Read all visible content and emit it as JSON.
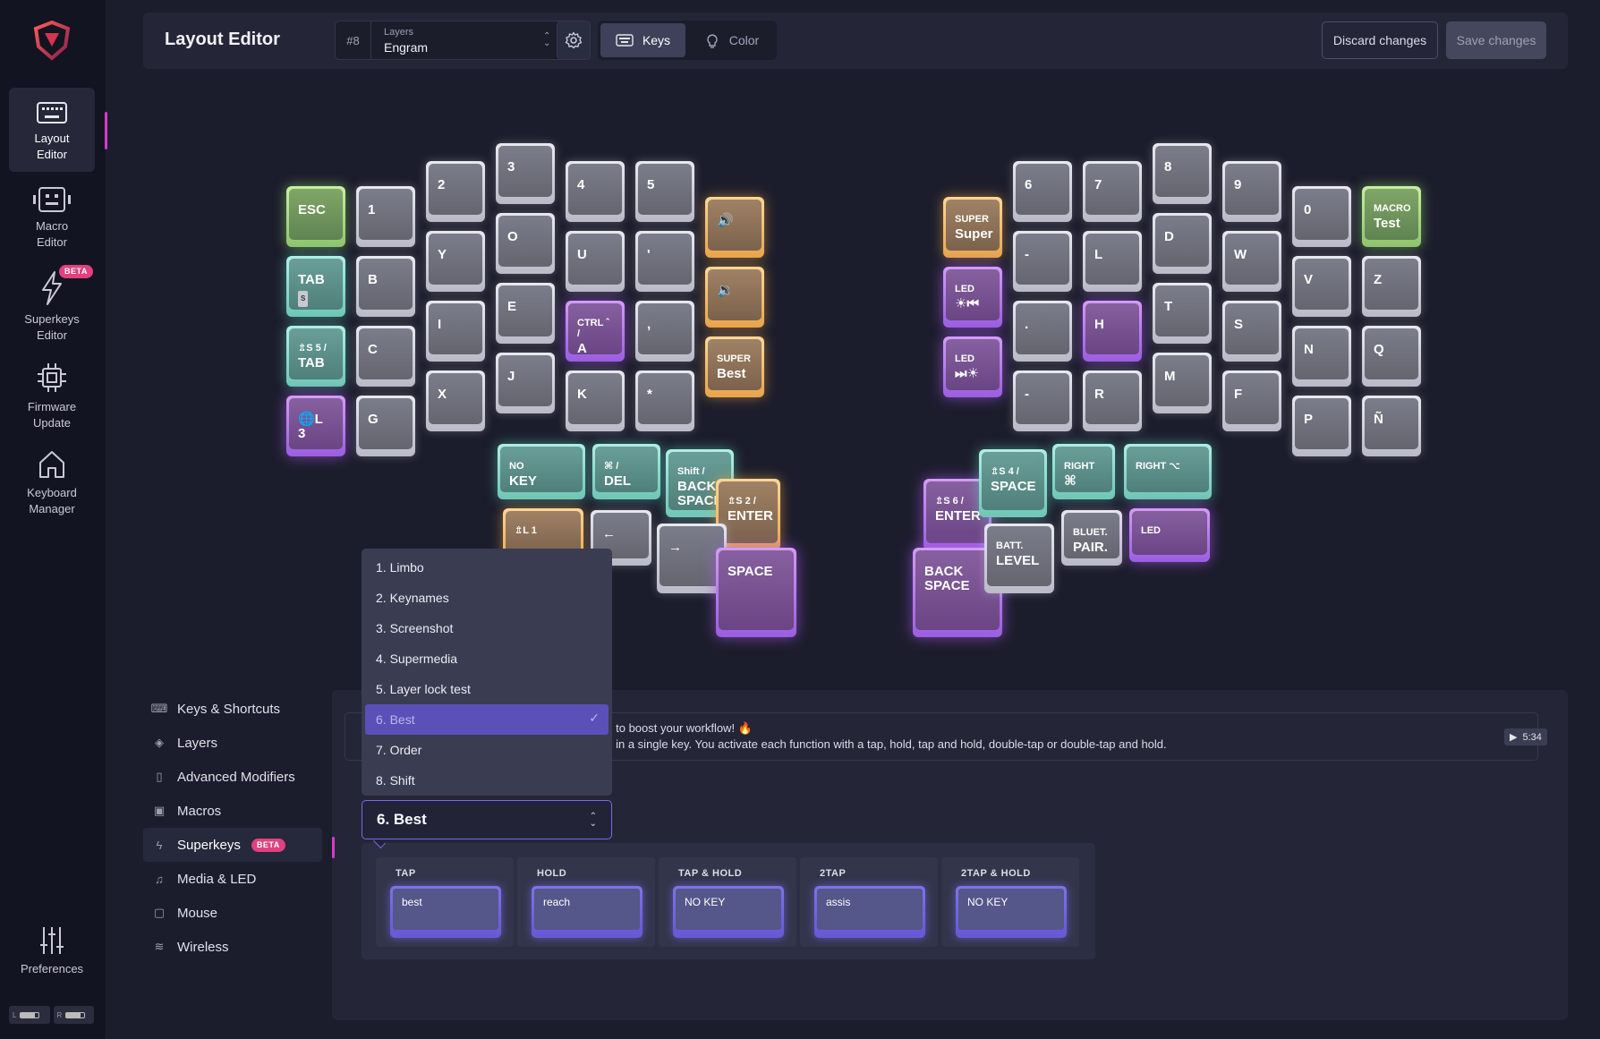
{
  "rail": {
    "items": [
      {
        "label_1": "Layout",
        "label_2": "Editor"
      },
      {
        "label_1": "Macro",
        "label_2": "Editor"
      },
      {
        "label_1": "Superkeys",
        "label_2": "Editor"
      },
      {
        "label_1": "Firmware",
        "label_2": "Update"
      },
      {
        "label_1": "Keyboard",
        "label_2": "Manager"
      }
    ],
    "beta": "BETA",
    "preferences": "Preferences",
    "battery": {
      "left": "L",
      "right": "R"
    }
  },
  "header": {
    "title": "Layout Editor",
    "layer_number": "#8",
    "layer_caption": "Layers",
    "layer_value": "Engram",
    "tab_keys": "Keys",
    "tab_color": "Color",
    "discard": "Discard changes",
    "save": "Save changes"
  },
  "keyboard": {
    "left_keys": [
      {
        "l1": "",
        "l2": "ESC",
        "color": "green"
      },
      {
        "l1": "",
        "l2": "1",
        "color": "gray"
      },
      {
        "l1": "",
        "l2": "2",
        "color": "gray"
      },
      {
        "l1": "",
        "l2": "3",
        "color": "gray"
      },
      {
        "l1": "",
        "l2": "4",
        "color": "gray"
      },
      {
        "l1": "",
        "l2": "5",
        "color": "gray"
      },
      {
        "l1": "",
        "l2": "🔊",
        "color": "orange"
      },
      {
        "l1": "",
        "l2": "TAB",
        "color": "teal",
        "badge": "S"
      },
      {
        "l1": "",
        "l2": "B",
        "color": "gray"
      },
      {
        "l1": "",
        "l2": "Y",
        "color": "gray"
      },
      {
        "l1": "",
        "l2": "O",
        "color": "gray"
      },
      {
        "l1": "",
        "l2": "U",
        "color": "gray"
      },
      {
        "l1": "",
        "l2": "'",
        "color": "gray"
      },
      {
        "l1": "",
        "l2": "🔉",
        "color": "orange"
      },
      {
        "l1": "⇬S 5 /",
        "l2": "TAB",
        "color": "teal"
      },
      {
        "l1": "",
        "l2": "C",
        "color": "gray"
      },
      {
        "l1": "",
        "l2": "I",
        "color": "gray"
      },
      {
        "l1": "",
        "l2": "E",
        "color": "gray"
      },
      {
        "l1": "CTRL ˆ /",
        "l2": "A",
        "color": "purple"
      },
      {
        "l1": "",
        "l2": ",",
        "color": "gray"
      },
      {
        "l1": "SUPER",
        "l2": "Best",
        "color": "orange"
      },
      {
        "l1": "",
        "l2": "🌐L 3",
        "color": "purple"
      },
      {
        "l1": "",
        "l2": "G",
        "color": "gray"
      },
      {
        "l1": "",
        "l2": "X",
        "color": "gray"
      },
      {
        "l1": "",
        "l2": "J",
        "color": "gray"
      },
      {
        "l1": "",
        "l2": "K",
        "color": "gray"
      },
      {
        "l1": "",
        "l2": "*",
        "color": "gray"
      }
    ],
    "left_thumb": [
      {
        "l1": "NO",
        "l2": "KEY",
        "color": "teal"
      },
      {
        "l1": "⌘ /",
        "l2": "DEL",
        "color": "teal"
      },
      {
        "l1": "Shift /",
        "l2": "BACK SPACE",
        "color": "teal"
      },
      {
        "l1": "⇬S 2 /",
        "l2": "ENTER",
        "color": "orange"
      },
      {
        "l1": "⇬L 1",
        "l2": "",
        "color": "orange"
      },
      {
        "l1": "",
        "l2": "←",
        "color": "gray"
      },
      {
        "l1": "",
        "l2": "→",
        "color": "gray"
      },
      {
        "l1": "",
        "l2": "SPACE",
        "color": "purple"
      }
    ],
    "right_keys": [
      {
        "l1": "SUPER",
        "l2": "Super",
        "color": "orange"
      },
      {
        "l1": "",
        "l2": "6",
        "color": "gray"
      },
      {
        "l1": "",
        "l2": "7",
        "color": "gray"
      },
      {
        "l1": "",
        "l2": "8",
        "color": "gray"
      },
      {
        "l1": "",
        "l2": "9",
        "color": "gray"
      },
      {
        "l1": "",
        "l2": "0",
        "color": "gray"
      },
      {
        "l1": "MACRO",
        "l2": "Test",
        "color": "green"
      },
      {
        "l1": "LED",
        "l2": "☀⏮",
        "color": "purple"
      },
      {
        "l1": "",
        "l2": "-",
        "color": "gray"
      },
      {
        "l1": "",
        "l2": "L",
        "color": "gray"
      },
      {
        "l1": "",
        "l2": "D",
        "color": "gray"
      },
      {
        "l1": "",
        "l2": "W",
        "color": "gray"
      },
      {
        "l1": "",
        "l2": "V",
        "color": "gray"
      },
      {
        "l1": "",
        "l2": "Z",
        "color": "gray"
      },
      {
        "l1": "LED",
        "l2": "⏭☀",
        "color": "purple"
      },
      {
        "l1": "",
        "l2": ".",
        "color": "gray"
      },
      {
        "l1": "",
        "l2": "H",
        "color": "purple"
      },
      {
        "l1": "",
        "l2": "T",
        "color": "gray"
      },
      {
        "l1": "",
        "l2": "S",
        "color": "gray"
      },
      {
        "l1": "",
        "l2": "N",
        "color": "gray"
      },
      {
        "l1": "",
        "l2": "Q",
        "color": "gray"
      },
      {
        "l1": "",
        "l2": "-",
        "color": "gray"
      },
      {
        "l1": "",
        "l2": "R",
        "color": "gray"
      },
      {
        "l1": "",
        "l2": "M",
        "color": "gray"
      },
      {
        "l1": "",
        "l2": "F",
        "color": "gray"
      },
      {
        "l1": "",
        "l2": "P",
        "color": "gray"
      },
      {
        "l1": "",
        "l2": "Ñ",
        "color": "gray"
      }
    ],
    "right_thumb": [
      {
        "l1": "⇬S 6 /",
        "l2": "ENTER",
        "color": "purple"
      },
      {
        "l1": "⇬S 4 /",
        "l2": "SPACE",
        "color": "teal"
      },
      {
        "l1": "RIGHT",
        "l2": "⌘",
        "color": "teal"
      },
      {
        "l1": "RIGHT ⌥",
        "l2": "",
        "color": "teal"
      },
      {
        "l1": "",
        "l2": "BACK SPACE",
        "color": "purple"
      },
      {
        "l1": "BATT.",
        "l2": "LEVEL",
        "color": "gray"
      },
      {
        "l1": "BLUET.",
        "l2": "PAIR.",
        "color": "gray"
      },
      {
        "l1": "LED",
        "l2": "",
        "color": "purple"
      }
    ],
    "colors": {
      "gray": "#6f717d",
      "green": "#8ec46c",
      "teal": "#6fc6b6",
      "purple": "#9a5ee0",
      "orange": "#e8a44c"
    }
  },
  "menu": {
    "items": [
      {
        "label": "Keys & Shortcuts",
        "icon": "keyboard-icon"
      },
      {
        "label": "Layers",
        "icon": "layers-icon"
      },
      {
        "label": "Advanced Modifiers",
        "icon": "modifiers-icon"
      },
      {
        "label": "Macros",
        "icon": "macro-icon"
      },
      {
        "label": "Superkeys",
        "icon": "bolt-icon",
        "badge": "BETA"
      },
      {
        "label": "Media & LED",
        "icon": "media-icon"
      },
      {
        "label": "Mouse",
        "icon": "mouse-icon"
      },
      {
        "label": "Wireless",
        "icon": "wifi-icon"
      }
    ]
  },
  "info": {
    "line1": "s to boost your workflow! 🔥",
    "line2": "s in a single key. You activate each function with a tap, hold, tap and hold, double-tap or double-tap and hold.",
    "video_time": "5:34"
  },
  "superkey_select": {
    "options": [
      "1. Limbo",
      "2. Keynames",
      "3. Screenshot",
      "4. Supermedia",
      "5. Layer lock test",
      "6. Best",
      "7. Order",
      "8. Shift"
    ],
    "selected": "6. Best",
    "check": "✓"
  },
  "actions": [
    {
      "label": "TAP",
      "value": "best"
    },
    {
      "label": "HOLD",
      "value": "reach"
    },
    {
      "label": "TAP & HOLD",
      "value": "NO KEY"
    },
    {
      "label": "2TAP",
      "value": "assis"
    },
    {
      "label": "2TAP & HOLD",
      "value": "NO KEY"
    }
  ]
}
